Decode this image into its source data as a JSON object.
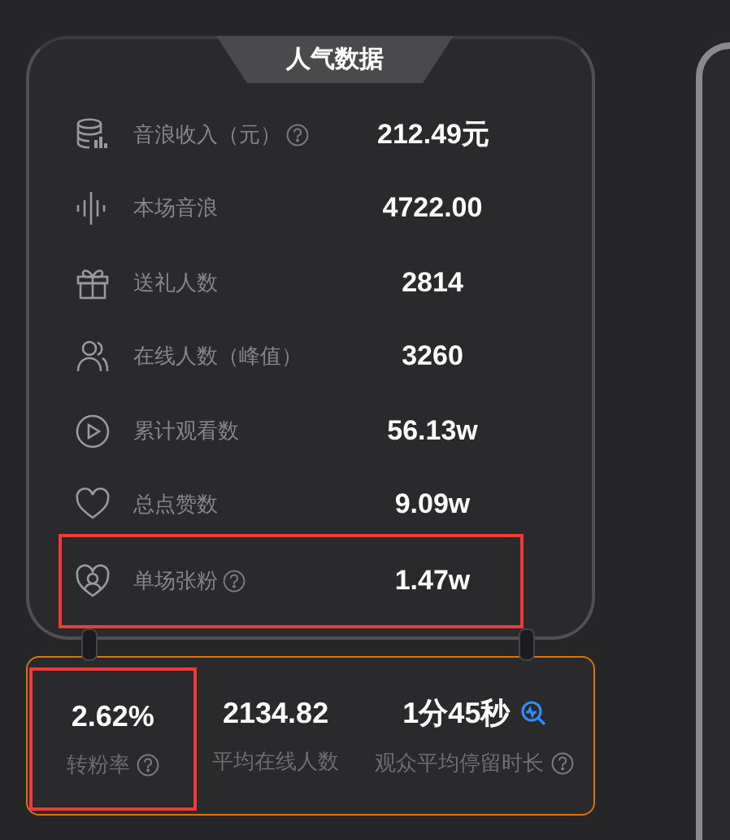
{
  "panel": {
    "title": "人气数据",
    "metrics": [
      {
        "kind": "database",
        "label": "音浪收入（元）",
        "help": true,
        "value": "212.49元",
        "highlighted": false
      },
      {
        "kind": "wave",
        "label": "本场音浪",
        "help": false,
        "value": "4722.00",
        "highlighted": false
      },
      {
        "kind": "gift",
        "label": "送礼人数",
        "help": false,
        "value": "2814",
        "highlighted": false
      },
      {
        "kind": "users",
        "label": "在线人数（峰值）",
        "help": false,
        "value": "3260",
        "highlighted": false
      },
      {
        "kind": "play",
        "label": "累计观看数",
        "help": false,
        "value": "56.13w",
        "highlighted": false
      },
      {
        "kind": "heart",
        "label": "总点赞数",
        "help": false,
        "value": "9.09w",
        "highlighted": false
      },
      {
        "kind": "fan",
        "label": "单场张粉",
        "help": true,
        "value": "1.47w",
        "highlighted": true
      }
    ]
  },
  "summary": {
    "stats": [
      {
        "value": "2.62%",
        "label": "转粉率",
        "help": true,
        "trend_icon": false,
        "highlighted": true
      },
      {
        "value": "2134.82",
        "label": "平均在线人数",
        "help": false,
        "trend_icon": false,
        "highlighted": false
      },
      {
        "value": "1分45秒",
        "label": "观众平均停留时长",
        "help": true,
        "trend_icon": true,
        "highlighted": false
      }
    ]
  }
}
